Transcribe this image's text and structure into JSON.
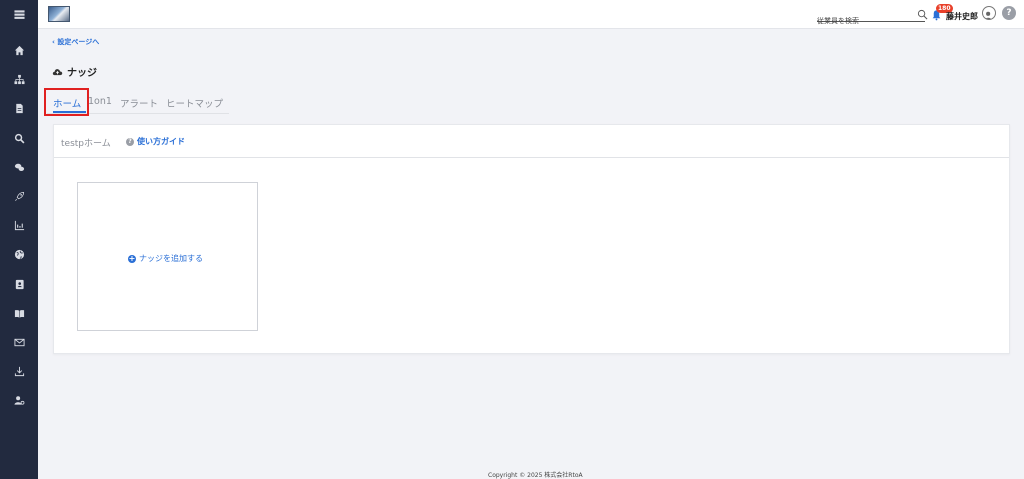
{
  "header": {
    "search_placeholder": "従業員を検索",
    "notification_count": "180",
    "user_name": "藤井史郎",
    "help_symbol": "?"
  },
  "breadcrumb": {
    "back_label": "設定ページへ"
  },
  "page": {
    "title": "ナッジ"
  },
  "tabs": [
    {
      "label": "ホーム",
      "active": true
    },
    {
      "label": "1on1",
      "active": false
    },
    {
      "label": "アラート",
      "active": false
    },
    {
      "label": "ヒートマップ",
      "active": false
    }
  ],
  "card": {
    "home_label": "testpホーム",
    "guide_label": "使い方ガイド",
    "add_label": "ナッジを追加する"
  },
  "footer": {
    "copyright": "Copyright © 2025 株式会社RtoA"
  },
  "sidebar": {
    "icons": [
      "menu-icon",
      "home-icon",
      "org-chart-icon",
      "document-icon",
      "search-icon",
      "chat-icon",
      "rocket-icon",
      "chart-icon",
      "globe-icon",
      "contacts-icon",
      "book-icon",
      "mail-icon",
      "download-icon",
      "user-settings-icon"
    ]
  },
  "colors": {
    "accent": "#2a6fd6",
    "sidebar": "#222a3f",
    "badge": "#e8402a",
    "highlight": "#e02020"
  }
}
